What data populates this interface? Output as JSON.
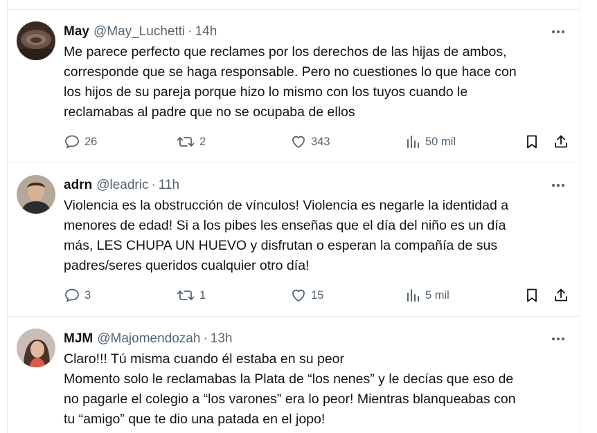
{
  "tweets": [
    {
      "name": "May",
      "handle": "@May_Luchetti",
      "separator": "·",
      "time": "14h",
      "lines": [
        "Me parece perfecto que reclames por los derechos de las hijas de ambos,",
        "corresponde que se haga responsable. Pero no cuestiones lo que hace con",
        "los hijos de su pareja porque hizo lo mismo con los tuyos cuando le",
        "reclamabas al padre que no se ocupaba de ellos"
      ],
      "replies": "26",
      "retweets": "2",
      "likes": "343",
      "views": "50 mil"
    },
    {
      "name": "adrn",
      "handle": "@leadric",
      "separator": "·",
      "time": "11h",
      "lines": [
        "Violencia es la obstrucción de vínculos! Violencia es negarle la identidad a",
        "menores de edad! Si a los pibes les enseñas que el día del niño es un día",
        "más, LES CHUPA UN HUEVO y disfrutan o esperan la compañía de sus",
        "padres/seres queridos cualquier otro día!"
      ],
      "replies": "3",
      "retweets": "1",
      "likes": "15",
      "views": "5 mil"
    },
    {
      "name": "MJM",
      "handle": "@Majomendozah",
      "separator": "·",
      "time": "13h",
      "lines": [
        "Claro!!! Tú misma cuando él estaba en su peor",
        "Momento solo le reclamabas la Plata de “los nenes” y le decías que eso de",
        "no pagarle el colegio a “los varones” era lo peor! Mientras blanqueabas con",
        "tu “amigo” que te dio una patada en el jopo!"
      ]
    }
  ],
  "icons": {
    "more": "more-horizontal-icon",
    "reply": "reply-bubble-icon",
    "retweet": "retweet-icon",
    "like": "heart-icon",
    "views": "views-bars-icon",
    "bookmark": "bookmark-icon",
    "share": "share-upload-icon"
  },
  "colors": {
    "text": "#0f1419",
    "secondary": "#536471",
    "divider": "#e6ecf0"
  }
}
